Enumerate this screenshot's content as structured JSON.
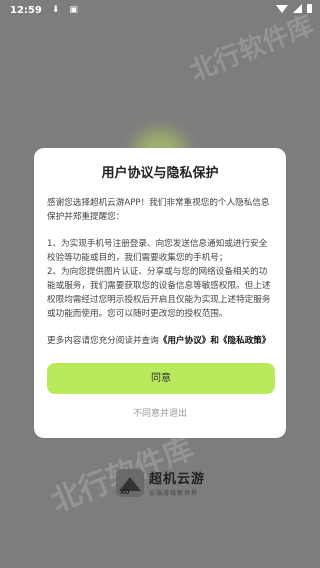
{
  "status_bar": {
    "time": "12:59",
    "icons": [
      "download-icon",
      "app-notification-icon",
      "wifi-icon",
      "signal-icon",
      "battery-icon"
    ]
  },
  "watermark": {
    "text_top": "北行软件库",
    "text_bottom": "北行软件库"
  },
  "dialog": {
    "title": "用户协议与隐私保护",
    "intro": "感谢您选择超机云游APP！我们非常重视您的个人隐私信息保护并郑重提醒您：",
    "item1": "1、为实现手机号注册登录、向您发送信息通知或进行安全校验等功能或目的，我们需要收集您的手机号；",
    "item2": "2、为向您提供图片认证、分享或与您的网络设备相关的功能或服务，我们需要获取您的设备信息等敏感权限。但上述权限均需经过您明示授权后开启且仅能为实现上述特定服务或功能而使用。您可以随时更改您的授权范围。",
    "more_prefix": "更多内容请您充分阅读并查询",
    "user_agreement_link": "《用户协议》",
    "and": "和",
    "privacy_policy_link": "《隐私政策》",
    "agree_button": "同意",
    "disagree_button": "不同意并退出"
  },
  "footer": {
    "logo_mark": "XO",
    "brand_name": "超机云游",
    "slogan": "云端游戏新世界"
  },
  "colors": {
    "accent": "#b9ea5c",
    "overlay": "#7d7d7d",
    "dialog_bg": "#ffffff"
  }
}
